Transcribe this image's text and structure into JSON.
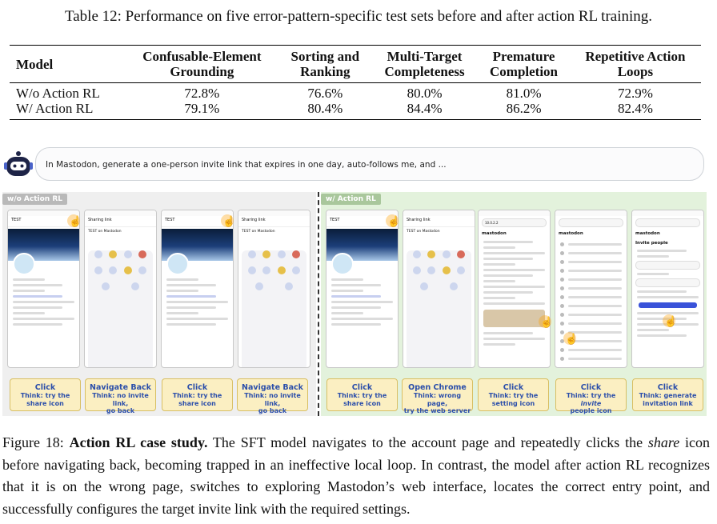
{
  "table": {
    "caption": "Table 12: Performance on five error-pattern-specific test sets before and after action RL training.",
    "headers": [
      [
        "Model",
        ""
      ],
      [
        "Confusable-Element",
        "Grounding"
      ],
      [
        "Sorting and",
        "Ranking"
      ],
      [
        "Multi-Target",
        "Completeness"
      ],
      [
        "Premature",
        "Completion"
      ],
      [
        "Repetitive Action",
        "Loops"
      ]
    ],
    "rows": [
      [
        "W/o Action RL",
        "72.8%",
        "76.6%",
        "80.0%",
        "81.0%",
        "72.9%"
      ],
      [
        "W/ Action RL",
        "79.1%",
        "80.4%",
        "84.4%",
        "86.2%",
        "82.4%"
      ]
    ]
  },
  "figure": {
    "prompt": "In Mastodon, generate a one-person invite link that expires in one day, auto-follows me, and ...",
    "left_label": "w/o Action RL",
    "right_label": "w/ Action RL",
    "screens": {
      "s1_title": "TEST",
      "s2_title": "Sharing link",
      "s2_item": "TEST on Mastodon",
      "s5_title": "Sharing link",
      "s6_url": "10.0.2.2",
      "s6_brand": "mastodon",
      "s8_brand": "mastodon",
      "s9_title": "Invite people"
    },
    "steps": [
      {
        "action": "Click",
        "think_prefix": "Think: try the",
        "think_em": "",
        "think_rest": "share icon"
      },
      {
        "action": "Navigate Back",
        "think_prefix": "Think: no invite link,",
        "think_em": "",
        "think_rest": "go back"
      },
      {
        "action": "Click",
        "think_prefix": "Think: try the",
        "think_em": "",
        "think_rest": "share icon"
      },
      {
        "action": "Navigate Back",
        "think_prefix": "Think: no invite link,",
        "think_em": "",
        "think_rest": "go back"
      },
      {
        "action": "Click",
        "think_prefix": "Think: try the",
        "think_em": "",
        "think_rest": "share icon"
      },
      {
        "action": "Open Chrome",
        "think_prefix": "Think: wrong page,",
        "think_em": "",
        "think_rest": "try the web server"
      },
      {
        "action": "Click",
        "think_prefix": "Think: try the",
        "think_em": "",
        "think_rest": "setting icon"
      },
      {
        "action": "Click",
        "think_prefix": "Think: try the",
        "think_em": "invite",
        "think_rest": "people icon"
      },
      {
        "action": "Click",
        "think_prefix": "Think: generate",
        "think_em": "",
        "think_rest": "invitation link"
      }
    ]
  },
  "caption": {
    "prefix": "Figure 18: ",
    "bold": "Action RL case study.",
    "t1": " The SFT model navigates to the account page and repeatedly clicks the ",
    "em": "share",
    "t2": " icon before navigating back, becoming trapped in an ineffective local loop. In contrast, the model after action RL recognizes that it is on the wrong page, switches to exploring Mastodon’s web interface, locates the correct entry point, and successfully configures the target invite link with the required settings."
  },
  "colors": {
    "left_panel": "#efefef",
    "right_panel": "#e3f2dc",
    "action_box": "#fbefc2",
    "action_text": "#2b4eaa"
  }
}
